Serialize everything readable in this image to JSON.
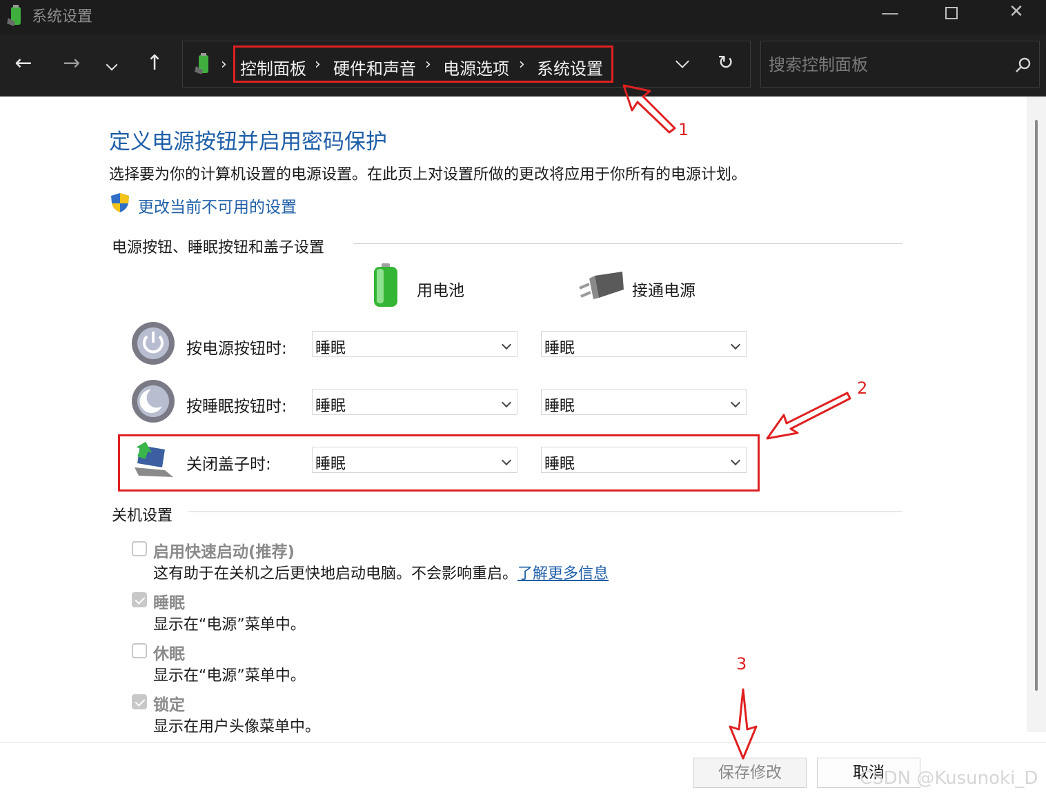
{
  "window": {
    "title": "系统设置"
  },
  "breadcrumb": [
    "控制面板",
    "硬件和声音",
    "电源选项",
    "系统设置"
  ],
  "search": {
    "placeholder": "搜索控制面板"
  },
  "page": {
    "heading": "定义电源按钮并启用密码保护",
    "description": "选择要为你的计算机设置的电源设置。在此页上对设置所做的更改将应用于你所有的电源计划。",
    "change_link": "更改当前不可用的设置"
  },
  "power_section": {
    "title": "电源按钮、睡眠按钮和盖子设置",
    "col_battery": "用电池",
    "col_plugged": "接通电源",
    "rows": [
      {
        "label": "按电源按钮时:",
        "battery": "睡眠",
        "plugged": "睡眠"
      },
      {
        "label": "按睡眠按钮时:",
        "battery": "睡眠",
        "plugged": "睡眠"
      },
      {
        "label": "关闭盖子时:",
        "battery": "睡眠",
        "plugged": "睡眠"
      }
    ]
  },
  "shutdown_section": {
    "title": "关机设置",
    "options": [
      {
        "label": "启用快速启动(推荐)",
        "desc": "这有助于在关机之后更快地启动电脑。不会影响重启。",
        "link": "了解更多信息",
        "checked": false
      },
      {
        "label": "睡眠",
        "desc": "显示在“电源”菜单中。",
        "checked": true
      },
      {
        "label": "休眠",
        "desc": "显示在“电源”菜单中。",
        "checked": false
      },
      {
        "label": "锁定",
        "desc": "显示在用户头像菜单中。",
        "checked": true
      }
    ]
  },
  "buttons": {
    "save": "保存修改",
    "cancel": "取消"
  },
  "annotations": [
    "1",
    "2",
    "3"
  ],
  "watermark": "CSDN @Kusunoki_D",
  "colors": {
    "link": "#1f5fa8",
    "annotation": "#e02020",
    "titlebar": "#1c1c1c",
    "navbar": "#202020"
  }
}
